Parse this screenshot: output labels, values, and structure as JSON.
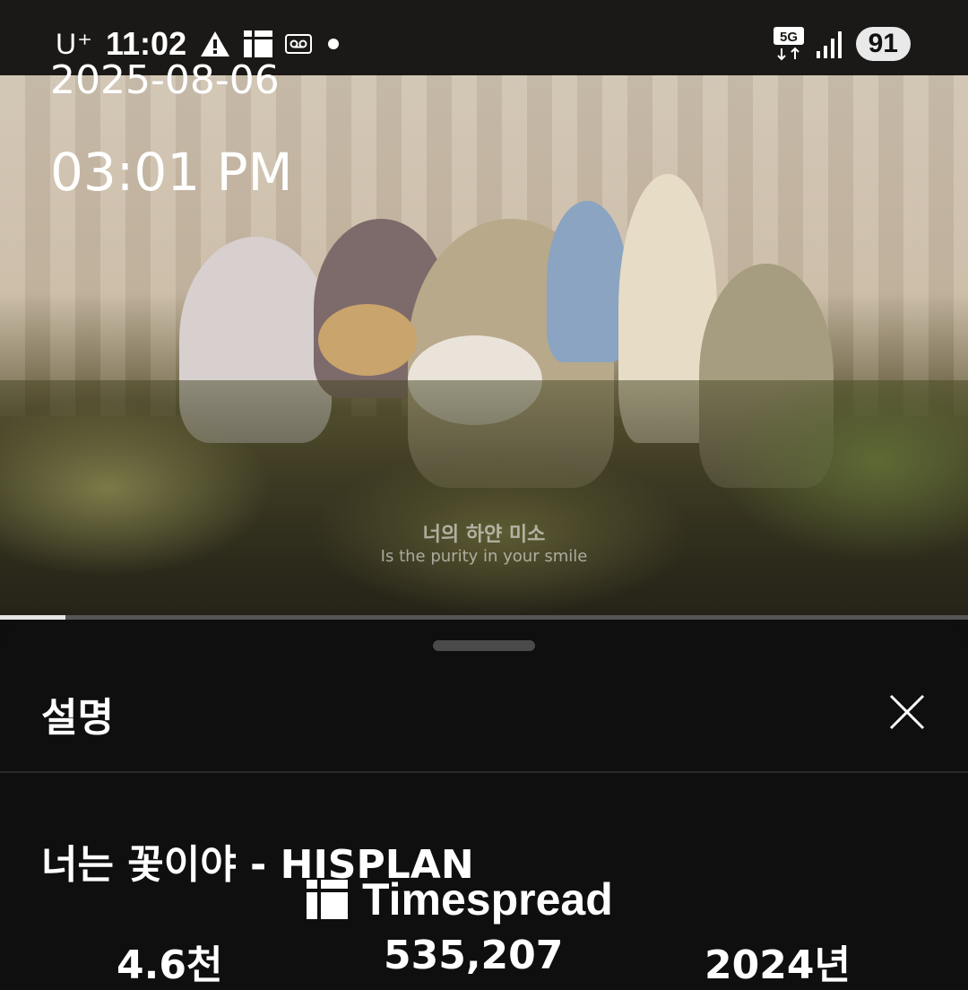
{
  "status_bar": {
    "carrier": "U⁺",
    "time": "11:02",
    "network": "5G",
    "battery": "91"
  },
  "overlay": {
    "date": "2025-08-06",
    "time": "03:01 PM"
  },
  "video": {
    "subtitle_ko": "너의 하얀 미소",
    "subtitle_en": "Is the purity in your smile",
    "progress": 0.068
  },
  "description_sheet": {
    "title": "설명",
    "video_title": "너는 꽃이야 - HISPLAN",
    "stats": [
      "4.6천",
      "535,207",
      "2024년"
    ]
  },
  "watermark": {
    "text": "Timespread"
  }
}
